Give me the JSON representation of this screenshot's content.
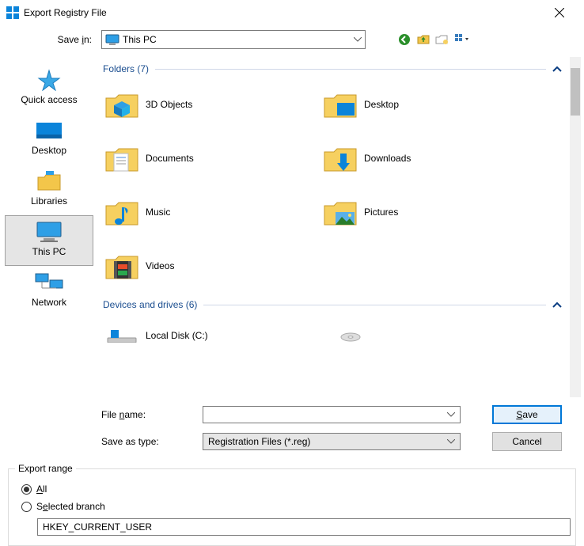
{
  "title": "Export Registry File",
  "savein_label": "Save in:",
  "savein_value": "This PC",
  "sidebar": {
    "items": [
      {
        "label": "Quick access"
      },
      {
        "label": "Desktop"
      },
      {
        "label": "Libraries"
      },
      {
        "label": "This PC"
      },
      {
        "label": "Network"
      }
    ]
  },
  "sections": {
    "folders_header": "Folders (7)",
    "devices_header": "Devices and drives (6)"
  },
  "folders": [
    {
      "label": "3D Objects"
    },
    {
      "label": "Desktop"
    },
    {
      "label": "Documents"
    },
    {
      "label": "Downloads"
    },
    {
      "label": "Music"
    },
    {
      "label": "Pictures"
    },
    {
      "label": "Videos"
    }
  ],
  "drives": [
    {
      "label": "Local Disk (C:)"
    }
  ],
  "filename_label": "File name:",
  "filename_value": "",
  "saveastype_label": "Save as type:",
  "saveastype_value": "Registration Files (*.reg)",
  "buttons": {
    "save": "Save",
    "cancel": "Cancel"
  },
  "export_range": {
    "legend": "Export range",
    "all": "All",
    "selected_branch": "Selected branch",
    "branch_value": "HKEY_CURRENT_USER"
  }
}
